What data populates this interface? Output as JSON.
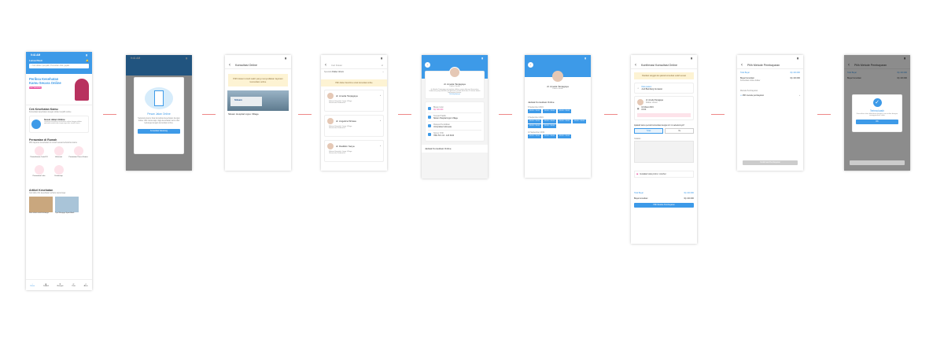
{
  "s1": {
    "time": "9:41 AM",
    "brand": "Lensa Pasti",
    "search": "Cari dokter, penyakit, Pencarian obat, gejala",
    "hero": "Periksa Kesehatan Kamu Secara Online",
    "hero_btn": "Cek Sekarang",
    "sec1": "Cek Kesehatan Kamu",
    "sec1_sub": "Konsultasi kesehatan dengan dokter terpilih online",
    "chat_t": "Sesat Jalan Online",
    "chat_d": "Layanan konsultasi kesehatan online dengan dokter spesialis terbaik dan terpercaya dari rumah kamu",
    "sec2": "Perawatan di Rumah",
    "sec2_sub": "Pilih layanan kesehatan di rumah sesuai kebutuhan kamu",
    "cats": [
      "Pemeriksaan Covid-19",
      "Vaksinasi",
      "Perawatan Pasca Kamar",
      "Perawatan Luka",
      "Fisioterapi"
    ],
    "sec3": "Artikel Kesehatan",
    "sec3_sub": "Cari tahu info kesehatan terbaru terpercaya",
    "arts": [
      "Diet sehat untuk keluarga",
      "Tips Menjaga Sport Anak"
    ],
    "tabs": [
      "Home",
      "Jadwal",
      "Riwayat",
      "Chat",
      "Akun"
    ]
  },
  "s2": {
    "modal_title": "Pesan Jalan Online",
    "modal_body": "Sekarang kamu bisa konsultasi kesehatan dengan dokter dari mana saja. Jaga kesehatan kamu dan keluarga dengan konsultasi online.",
    "modal_btn": "Konsultasi Sekarang"
  },
  "s3": {
    "title": "Konsultasi Online",
    "warn": "Pilih lokasi rumah sakit yang menyediakan layanan konsultasi online",
    "hospital": "Siloam Hospital Lippo Village"
  },
  "s4": {
    "search": "Cari Dokter",
    "filter": "Spesialis",
    "filter_val": "Dokter Umum",
    "warn": "Pilih dokter favoritmu untuk konsultasi online",
    "docs": [
      {
        "name": "dr. Amelia Tanjagaya",
        "h1": "Siloam Hospitals Lippo Village",
        "h2": "Universitas Indonesia"
      },
      {
        "name": "dr. Angelica Wirasa",
        "h1": "Siloam Hospitals Lippo Village",
        "h2": "Universitas Indonesia"
      },
      {
        "name": "dr. Raditkin Setya",
        "h1": "Siloam Hospitals Lippo Village",
        "h2": "Universitas Indonesia"
      }
    ]
  },
  "s5": {
    "name": "dr. Amelia Tanjagaya",
    "role": "Dokter Umum",
    "bio": "dr. Amelia Tanjagaya merupakan dokter umum lulusan Universitas Indonesia yang memiliki pengalaman praktik lebih dari 10 tahun dalam menangani pasien.",
    "more": "Selengkapnya",
    "fee_l": "Biaya mulai",
    "fee": "Rp 100.000",
    "place_l": "Tempat Praktik",
    "place": "Siloam Hospital Lippo Village",
    "edu_l": "Riwayat Pendidikan",
    "edu": "Universitas Indonesia",
    "str_l": "Nomor STR",
    "str": "7801 53 1 16 - 123 3100",
    "sched": "Jadwal Konsultasi Online"
  },
  "s6": {
    "name": "dr. Amelia Tanjagaya",
    "role": "Dokter Umum",
    "sched": "Jadwal Konsultasi Online",
    "days": [
      {
        "d": "8 September 2019",
        "slots": [
          "09:00 - 10:00",
          "09:00 - 10:00",
          "09:00 - 10:00"
        ]
      },
      {
        "d": "9 September 2019",
        "slots": [
          "09:00 - 10:00",
          "09:00 - 10:00",
          "09:00 - 10:00",
          "09:00 - 10:00",
          "09:00 - 10:00",
          "09:00 - 10:00"
        ]
      },
      {
        "d": "10 September 2019",
        "slots": [
          "09:00 - 10:00",
          "09:00 - 10:00",
          "09:00 - 10:00"
        ]
      }
    ]
  },
  "s7": {
    "title": "Konfirmasi Konsultasi Online",
    "warn": "Pastikan tanggal dan jadwal konsultasi sudah sesuai",
    "patient_l": "Data pasien",
    "patient": "Audi Bambang Gunawan",
    "doc": "dr. Amelia Tanjagaya",
    "doc_role": "Dokter Umum",
    "date": "10 Maret 2019",
    "time": "15:00",
    "q": "Apakah kamu pernah konsultasi dengan dr. ini sebelumnya?",
    "yes": "Tidak",
    "no": "Ya",
    "notes_l": "Catatan",
    "promo": "Gunakan kode promo / voucher",
    "total_l": "Total Bayar",
    "total": "Rp 100.000",
    "fee_l": "Biaya konsultasi",
    "fee": "Rp 100.000",
    "btn": "Pilih Metode Pembayaran"
  },
  "s8": {
    "title": "Pilih Metode Pembayaran",
    "total_l": "Total Bayar",
    "total": "Rp 100.000",
    "fee_l": "Biaya Konsultasi",
    "fee": "Rp 100.000",
    "note": "Konsultasi online dokter",
    "pm_l": "Metode Pembayaran",
    "pm": "Pilih metode pembayaran",
    "btn": "Konfirmasi Pembayaran"
  },
  "s9": {
    "title": "Pilih Metode Pembayaran",
    "total_l": "Total Bayar",
    "total": "Rp 100.000",
    "fee_l": "Biaya Konsultasi",
    "fee": "Rp 100.000",
    "ok_title": "Terima kasih",
    "ok_body": "Konsultasi akan dilakukan dengan cara online dengan menggunakan video",
    "ok_btn": "OK"
  }
}
